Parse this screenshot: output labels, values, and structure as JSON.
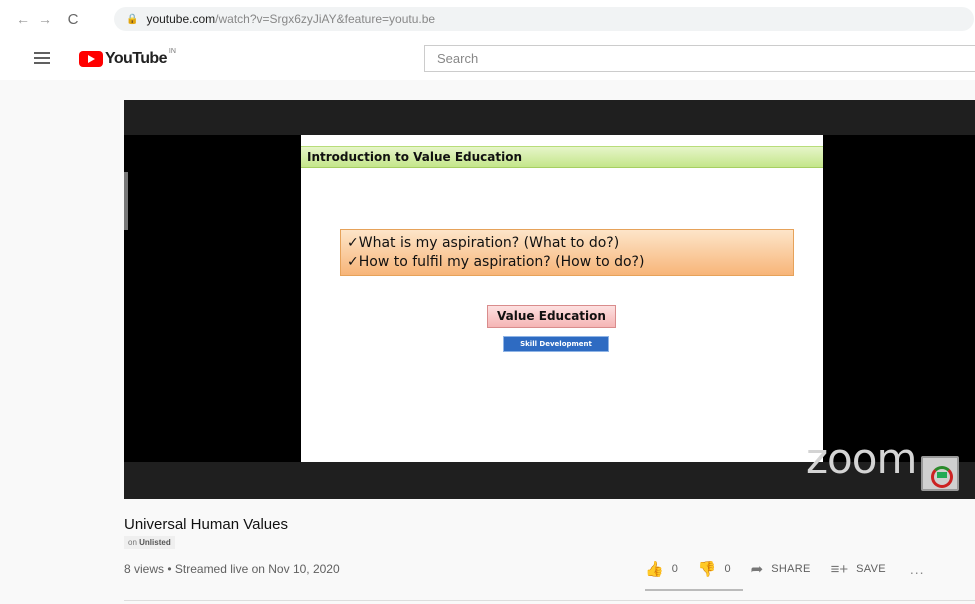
{
  "browser": {
    "back_icon": "←",
    "forward_icon": "→",
    "reload_icon": "C",
    "url_host": "youtube.com",
    "url_rest": "/watch?v=Srgx6zyJiAY&feature=youtu.be"
  },
  "header": {
    "logo_text": "YouTube",
    "country": "IN",
    "search_placeholder": "Search"
  },
  "slide": {
    "title": "Introduction to Value Education",
    "lines": [
      "✓What is my aspiration? (What to do?)",
      "✓How to fulfil my aspiration? (How to do?)"
    ],
    "value_education": "Value Education",
    "skill_development": "Skill Development"
  },
  "player": {
    "watermark": "zoom"
  },
  "video": {
    "title": "Universal Human Values",
    "visibility_prefix": "on",
    "visibility": "Unlisted",
    "meta": "8 views • Streamed live on Nov 10, 2020",
    "likes": "0",
    "dislikes": "0",
    "share_label": "SHARE",
    "save_label": "SAVE",
    "more_label": "..."
  }
}
